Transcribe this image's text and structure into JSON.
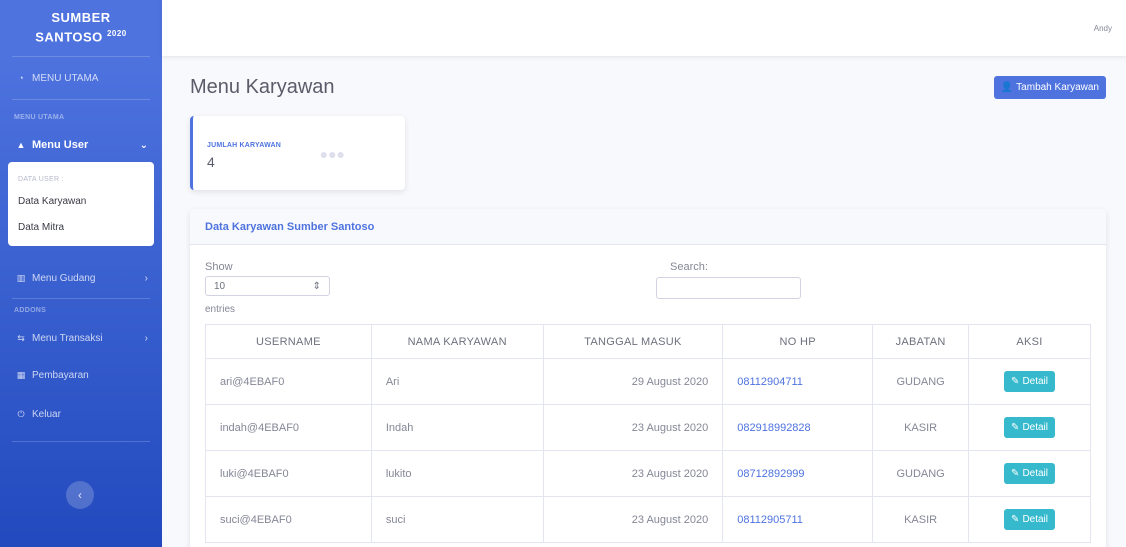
{
  "sidebar": {
    "brand_line1": "SUMBER",
    "brand_line2": "SANTOSO",
    "brand_year": "2020",
    "dashboard": "MENU UTAMA",
    "heading_main": "MENU UTAMA",
    "menu_user": "Menu User",
    "submenu_heading": "DATA USER :",
    "submenu_items": [
      "Data Karyawan",
      "Data Mitra"
    ],
    "menu_gudang": "Menu Gudang",
    "heading_addons": "ADDONS",
    "menu_transaksi": "Menu Transaksi",
    "pembayaran": "Pembayaran",
    "keluar": "Keluar",
    "toggle_glyph": "‹"
  },
  "topbar": {
    "user_name": "Andy"
  },
  "page": {
    "title": "Menu Karyawan",
    "add_button": "Tambah Karyawan"
  },
  "stat": {
    "label": "JUMLAH KARYAWAN",
    "value": "4"
  },
  "table_card": {
    "header": "Data Karyawan Sumber Santoso",
    "show_label": "Show",
    "select_value": "10",
    "entries_label": "entries",
    "search_label": "Search:",
    "columns": [
      "USERNAME",
      "NAMA KARYAWAN",
      "TANGGAL MASUK",
      "NO HP",
      "JABATAN",
      "AKSI"
    ],
    "rows": [
      {
        "username": "ari@4EBAF0",
        "nama": "Ari",
        "tanggal": "29 August 2020",
        "no_hp": "08112904711",
        "jabatan": "GUDANG",
        "aksi": "Detail"
      },
      {
        "username": "indah@4EBAF0",
        "nama": "Indah",
        "tanggal": "23 August 2020",
        "no_hp": "082918992828",
        "jabatan": "KASIR",
        "aksi": "Detail"
      },
      {
        "username": "luki@4EBAF0",
        "nama": "lukito",
        "tanggal": "23 August 2020",
        "no_hp": "08712892999",
        "jabatan": "GUDANG",
        "aksi": "Detail"
      },
      {
        "username": "suci@4EBAF0",
        "nama": "suci",
        "tanggal": "23 August 2020",
        "no_hp": "08112905711",
        "jabatan": "KASIR",
        "aksi": "Detail"
      }
    ]
  },
  "colors": {
    "primary": "#4e73df",
    "info": "#36b9cc",
    "sidebar_dark": "#224abe"
  },
  "icons": {
    "dashboard": "tachometer-icon",
    "user": "user-icon",
    "gudang": "warehouse-icon",
    "transaksi": "exchange-icon",
    "pembayaran": "table-icon",
    "keluar": "power-icon",
    "add": "user-plus-icon",
    "stat": "users-icon",
    "detail": "edit-icon"
  }
}
